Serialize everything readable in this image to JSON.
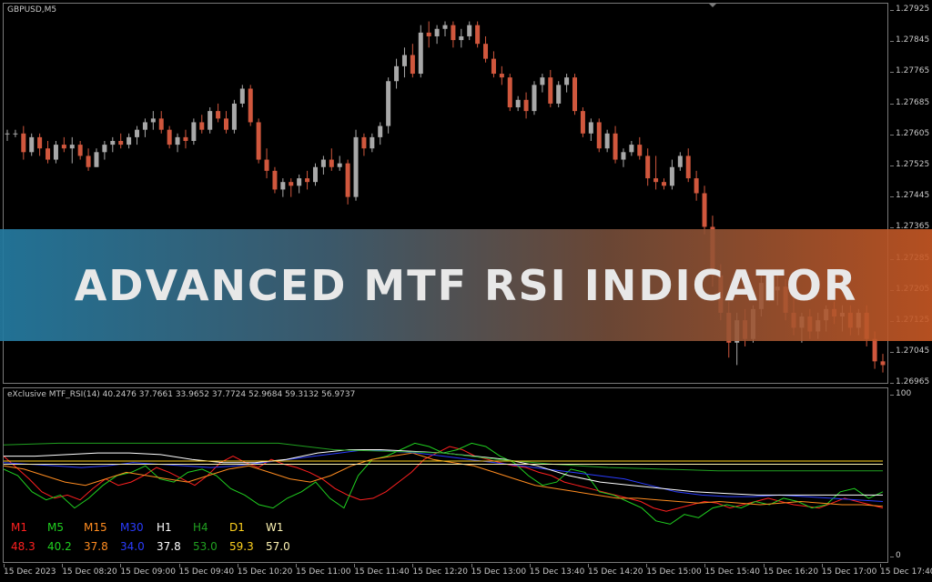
{
  "chart_title": "GBPUSD,M5",
  "indicator_label": "eXclusive MTF_RSI(14) 40.2476 37.7661 33.9652 37.7724 52.9684 59.3132 56.9737",
  "banner_text": "ADVANCED MTF RSI INDICATOR",
  "colors": {
    "bull": "#a8a8a8",
    "bear": "#d0573d",
    "grid": "#7a7a7a"
  },
  "price_axis": [
    "1.27925",
    "1.27845",
    "1.27765",
    "1.27685",
    "1.27605",
    "1.27525",
    "1.27445",
    "1.27365",
    "1.27285",
    "1.27205",
    "1.27125",
    "1.27045",
    "1.26965"
  ],
  "sub_axis": [
    "100",
    "0"
  ],
  "time_axis": [
    "15 Dec 2023",
    "15 Dec 08:20",
    "15 Dec 09:00",
    "15 Dec 09:40",
    "15 Dec 10:20",
    "15 Dec 11:00",
    "15 Dec 11:40",
    "15 Dec 12:20",
    "15 Dec 13:00",
    "15 Dec 13:40",
    "15 Dec 14:20",
    "15 Dec 15:00",
    "15 Dec 15:40",
    "15 Dec 16:20",
    "15 Dec 17:00",
    "15 Dec 17:40"
  ],
  "rsi_legend": [
    {
      "tf": "M1",
      "value": "48.3",
      "color": "#ff2020"
    },
    {
      "tf": "M5",
      "value": "40.2",
      "color": "#20d020"
    },
    {
      "tf": "M15",
      "value": "37.8",
      "color": "#ff8c20"
    },
    {
      "tf": "M30",
      "value": "34.0",
      "color": "#2a3cff"
    },
    {
      "tf": "H1",
      "value": "37.8",
      "color": "#ffffff"
    },
    {
      "tf": "H4",
      "value": "53.0",
      "color": "#20a020"
    },
    {
      "tf": "D1",
      "value": "59.3",
      "color": "#ffd21e"
    },
    {
      "tf": "W1",
      "value": "57.0",
      "color": "#fff5b4"
    }
  ],
  "chart_data": {
    "type": "candlestick",
    "symbol": "GBPUSD",
    "timeframe": "M5",
    "ylim": [
      1.2693,
      1.2795
    ],
    "candles": [
      [
        1.276,
        1.2761,
        1.2758,
        1.276
      ],
      [
        1.276,
        1.2761,
        1.2759,
        1.276
      ],
      [
        1.276,
        1.2762,
        1.2753,
        1.2755
      ],
      [
        1.2755,
        1.276,
        1.2754,
        1.2759
      ],
      [
        1.2759,
        1.276,
        1.2754,
        1.2756
      ],
      [
        1.2756,
        1.2758,
        1.2752,
        1.2753
      ],
      [
        1.2753,
        1.2758,
        1.2752,
        1.2757
      ],
      [
        1.2757,
        1.2759,
        1.2755,
        1.2756
      ],
      [
        1.2756,
        1.2759,
        1.2752,
        1.2757
      ],
      [
        1.2757,
        1.2758,
        1.2753,
        1.2754
      ],
      [
        1.2754,
        1.2756,
        1.275,
        1.2751
      ],
      [
        1.2751,
        1.2756,
        1.2751,
        1.2755
      ],
      [
        1.2755,
        1.2758,
        1.2753,
        1.2757
      ],
      [
        1.2757,
        1.2759,
        1.2755,
        1.2758
      ],
      [
        1.2758,
        1.276,
        1.2756,
        1.2757
      ],
      [
        1.2757,
        1.276,
        1.2756,
        1.2759
      ],
      [
        1.2759,
        1.2762,
        1.2757,
        1.2761
      ],
      [
        1.2761,
        1.2764,
        1.2759,
        1.2763
      ],
      [
        1.2763,
        1.2766,
        1.2761,
        1.2764
      ],
      [
        1.2764,
        1.2766,
        1.276,
        1.2761
      ],
      [
        1.2761,
        1.2762,
        1.2756,
        1.2757
      ],
      [
        1.2757,
        1.276,
        1.2755,
        1.2759
      ],
      [
        1.2759,
        1.2761,
        1.2756,
        1.2758
      ],
      [
        1.2758,
        1.2764,
        1.2757,
        1.2763
      ],
      [
        1.2763,
        1.2765,
        1.276,
        1.2761
      ],
      [
        1.2761,
        1.2767,
        1.276,
        1.2766
      ],
      [
        1.2766,
        1.2768,
        1.2763,
        1.2764
      ],
      [
        1.2764,
        1.2766,
        1.276,
        1.2761
      ],
      [
        1.2761,
        1.2769,
        1.276,
        1.2768
      ],
      [
        1.2768,
        1.2773,
        1.2767,
        1.2772
      ],
      [
        1.2772,
        1.2773,
        1.2762,
        1.2763
      ],
      [
        1.2763,
        1.2764,
        1.2752,
        1.2753
      ],
      [
        1.2753,
        1.2756,
        1.2748,
        1.275
      ],
      [
        1.275,
        1.2751,
        1.2744,
        1.2745
      ],
      [
        1.2745,
        1.2748,
        1.2743,
        1.2747
      ],
      [
        1.2747,
        1.2748,
        1.2743,
        1.2746
      ],
      [
        1.2746,
        1.2749,
        1.2744,
        1.2748
      ],
      [
        1.2748,
        1.275,
        1.2745,
        1.2747
      ],
      [
        1.2747,
        1.2752,
        1.2746,
        1.2751
      ],
      [
        1.2751,
        1.2754,
        1.2749,
        1.2753
      ],
      [
        1.2753,
        1.2756,
        1.275,
        1.2751
      ],
      [
        1.2751,
        1.2754,
        1.275,
        1.2752
      ],
      [
        1.2752,
        1.2753,
        1.2741,
        1.2743
      ],
      [
        1.2743,
        1.2761,
        1.2742,
        1.2759
      ],
      [
        1.2759,
        1.276,
        1.2754,
        1.2756
      ],
      [
        1.2756,
        1.276,
        1.2755,
        1.2759
      ],
      [
        1.2759,
        1.2763,
        1.2757,
        1.2762
      ],
      [
        1.2762,
        1.2775,
        1.276,
        1.2774
      ],
      [
        1.2774,
        1.278,
        1.2772,
        1.2778
      ],
      [
        1.2778,
        1.2783,
        1.2775,
        1.2781
      ],
      [
        1.2781,
        1.2784,
        1.2775,
        1.2776
      ],
      [
        1.2776,
        1.2789,
        1.2775,
        1.2787
      ],
      [
        1.2787,
        1.279,
        1.2783,
        1.2786
      ],
      [
        1.2786,
        1.2789,
        1.2784,
        1.2788
      ],
      [
        1.2788,
        1.279,
        1.2786,
        1.2789
      ],
      [
        1.2789,
        1.279,
        1.2783,
        1.2785
      ],
      [
        1.2785,
        1.2788,
        1.2783,
        1.2786
      ],
      [
        1.2786,
        1.279,
        1.2785,
        1.2789
      ],
      [
        1.2789,
        1.279,
        1.2783,
        1.2784
      ],
      [
        1.2784,
        1.2786,
        1.2779,
        1.278
      ],
      [
        1.278,
        1.2782,
        1.2775,
        1.2776
      ],
      [
        1.2776,
        1.2778,
        1.2773,
        1.2775
      ],
      [
        1.2775,
        1.2776,
        1.2766,
        1.2767
      ],
      [
        1.2767,
        1.277,
        1.2766,
        1.2769
      ],
      [
        1.2769,
        1.2771,
        1.2764,
        1.2766
      ],
      [
        1.2766,
        1.2774,
        1.2765,
        1.2773
      ],
      [
        1.2773,
        1.2776,
        1.2771,
        1.2775
      ],
      [
        1.2775,
        1.2777,
        1.2767,
        1.2768
      ],
      [
        1.2768,
        1.2774,
        1.2767,
        1.2773
      ],
      [
        1.2773,
        1.2776,
        1.2771,
        1.2775
      ],
      [
        1.2775,
        1.2776,
        1.2765,
        1.2766
      ],
      [
        1.2766,
        1.2767,
        1.2759,
        1.276
      ],
      [
        1.276,
        1.2764,
        1.2758,
        1.2763
      ],
      [
        1.2763,
        1.2764,
        1.2755,
        1.2756
      ],
      [
        1.2756,
        1.2761,
        1.2755,
        1.276
      ],
      [
        1.276,
        1.2762,
        1.2752,
        1.2753
      ],
      [
        1.2753,
        1.2756,
        1.2751,
        1.2755
      ],
      [
        1.2755,
        1.2758,
        1.2754,
        1.2757
      ],
      [
        1.2757,
        1.2759,
        1.2753,
        1.2754
      ],
      [
        1.2754,
        1.2756,
        1.2746,
        1.2748
      ],
      [
        1.2748,
        1.2754,
        1.2745,
        1.2747
      ],
      [
        1.2747,
        1.2748,
        1.2745,
        1.2746
      ],
      [
        1.2746,
        1.2753,
        1.2745,
        1.2751
      ],
      [
        1.2751,
        1.2755,
        1.275,
        1.2754
      ],
      [
        1.2754,
        1.2756,
        1.2747,
        1.2748
      ],
      [
        1.2748,
        1.275,
        1.2742,
        1.2744
      ],
      [
        1.2744,
        1.2746,
        1.2733,
        1.2735
      ],
      [
        1.2735,
        1.2738,
        1.2719,
        1.2722
      ],
      [
        1.2722,
        1.2725,
        1.271,
        1.2712
      ],
      [
        1.2712,
        1.2715,
        1.27,
        1.2704
      ],
      [
        1.2704,
        1.2712,
        1.2698,
        1.271
      ],
      [
        1.271,
        1.2713,
        1.2703,
        1.2705
      ],
      [
        1.2705,
        1.2714,
        1.2704,
        1.2713
      ],
      [
        1.2713,
        1.2722,
        1.2711,
        1.272
      ],
      [
        1.272,
        1.2723,
        1.2715,
        1.2718
      ],
      [
        1.2718,
        1.2722,
        1.2714,
        1.2719
      ],
      [
        1.2719,
        1.2721,
        1.271,
        1.2712
      ],
      [
        1.2712,
        1.2716,
        1.2706,
        1.2708
      ],
      [
        1.2708,
        1.2712,
        1.2704,
        1.2711
      ],
      [
        1.2711,
        1.2713,
        1.2705,
        1.2707
      ],
      [
        1.2707,
        1.2712,
        1.2705,
        1.271
      ],
      [
        1.271,
        1.2714,
        1.2707,
        1.2713
      ],
      [
        1.2713,
        1.2715,
        1.2709,
        1.2711
      ],
      [
        1.2711,
        1.2714,
        1.2707,
        1.2712
      ],
      [
        1.2712,
        1.2714,
        1.2706,
        1.2708
      ],
      [
        1.2708,
        1.2713,
        1.2706,
        1.2712
      ],
      [
        1.2712,
        1.2714,
        1.2703,
        1.2705
      ],
      [
        1.2705,
        1.2707,
        1.2697,
        1.2699
      ],
      [
        1.2699,
        1.2701,
        1.2696,
        1.2698
      ]
    ],
    "rsi_series": [
      {
        "name": "M1",
        "color": "#ff2020",
        "values": [
          62,
          55,
          48,
          40,
          36,
          38,
          35,
          42,
          48,
          44,
          46,
          50,
          55,
          52,
          48,
          44,
          50,
          58,
          62,
          58,
          55,
          60,
          57,
          55,
          52,
          48,
          42,
          38,
          35,
          36,
          40,
          46,
          52,
          60,
          64,
          68,
          66,
          62,
          60,
          58,
          56,
          55,
          52,
          50,
          46,
          44,
          42,
          40,
          38,
          36,
          34,
          30,
          28,
          30,
          32,
          34,
          33,
          30,
          32,
          34,
          36,
          34,
          32,
          31,
          30,
          33,
          36,
          34,
          32,
          30
        ]
      },
      {
        "name": "M5",
        "color": "#20d020",
        "values": [
          54,
          50,
          40,
          35,
          38,
          30,
          36,
          44,
          50,
          52,
          56,
          48,
          46,
          52,
          54,
          50,
          42,
          38,
          32,
          30,
          36,
          40,
          46,
          36,
          30,
          50,
          60,
          62,
          66,
          70,
          68,
          64,
          66,
          70,
          68,
          62,
          58,
          50,
          44,
          46,
          54,
          52,
          40,
          38,
          34,
          30,
          22,
          20,
          26,
          24,
          30,
          32,
          30,
          34,
          32,
          36,
          34,
          30,
          32,
          40,
          42,
          36,
          40
        ]
      },
      {
        "name": "M15",
        "color": "#ff8c20",
        "values": [
          56,
          54,
          50,
          46,
          44,
          48,
          52,
          50,
          48,
          46,
          50,
          54,
          56,
          52,
          48,
          46,
          50,
          56,
          60,
          62,
          64,
          60,
          58,
          56,
          52,
          48,
          44,
          42,
          40,
          38,
          36,
          36,
          35,
          34,
          33,
          34,
          33,
          32,
          33,
          34,
          33,
          32,
          32,
          31
        ]
      },
      {
        "name": "M30",
        "color": "#2a3cff",
        "values": [
          58,
          57,
          56,
          55,
          56,
          58,
          57,
          56,
          55,
          56,
          58,
          60,
          62,
          64,
          66,
          65,
          64,
          62,
          60,
          58,
          56,
          54,
          52,
          50,
          48,
          44,
          40,
          38,
          37,
          37,
          38,
          37,
          36,
          35,
          34
        ]
      },
      {
        "name": "H1",
        "color": "#ffffff",
        "values": [
          62,
          62,
          63,
          64,
          64,
          63,
          60,
          58,
          58,
          60,
          64,
          66,
          66,
          65,
          64,
          62,
          60,
          56,
          50,
          46,
          44,
          42,
          40,
          39,
          38,
          38,
          38,
          38,
          38
        ]
      },
      {
        "name": "H4",
        "color": "#20a020",
        "values": [
          69,
          70,
          70,
          70,
          70,
          70,
          66,
          65,
          64,
          60,
          57,
          55,
          54,
          53,
          53,
          53,
          53
        ]
      },
      {
        "name": "D1",
        "color": "#ffd21e",
        "values": [
          59,
          59,
          59,
          59,
          59,
          59,
          59,
          59,
          59,
          59
        ]
      },
      {
        "name": "W1",
        "color": "#fff5b4",
        "values": [
          57,
          57,
          57,
          57,
          57,
          57,
          57,
          57,
          57,
          57
        ]
      }
    ],
    "rsi_ylim": [
      0,
      100
    ]
  }
}
